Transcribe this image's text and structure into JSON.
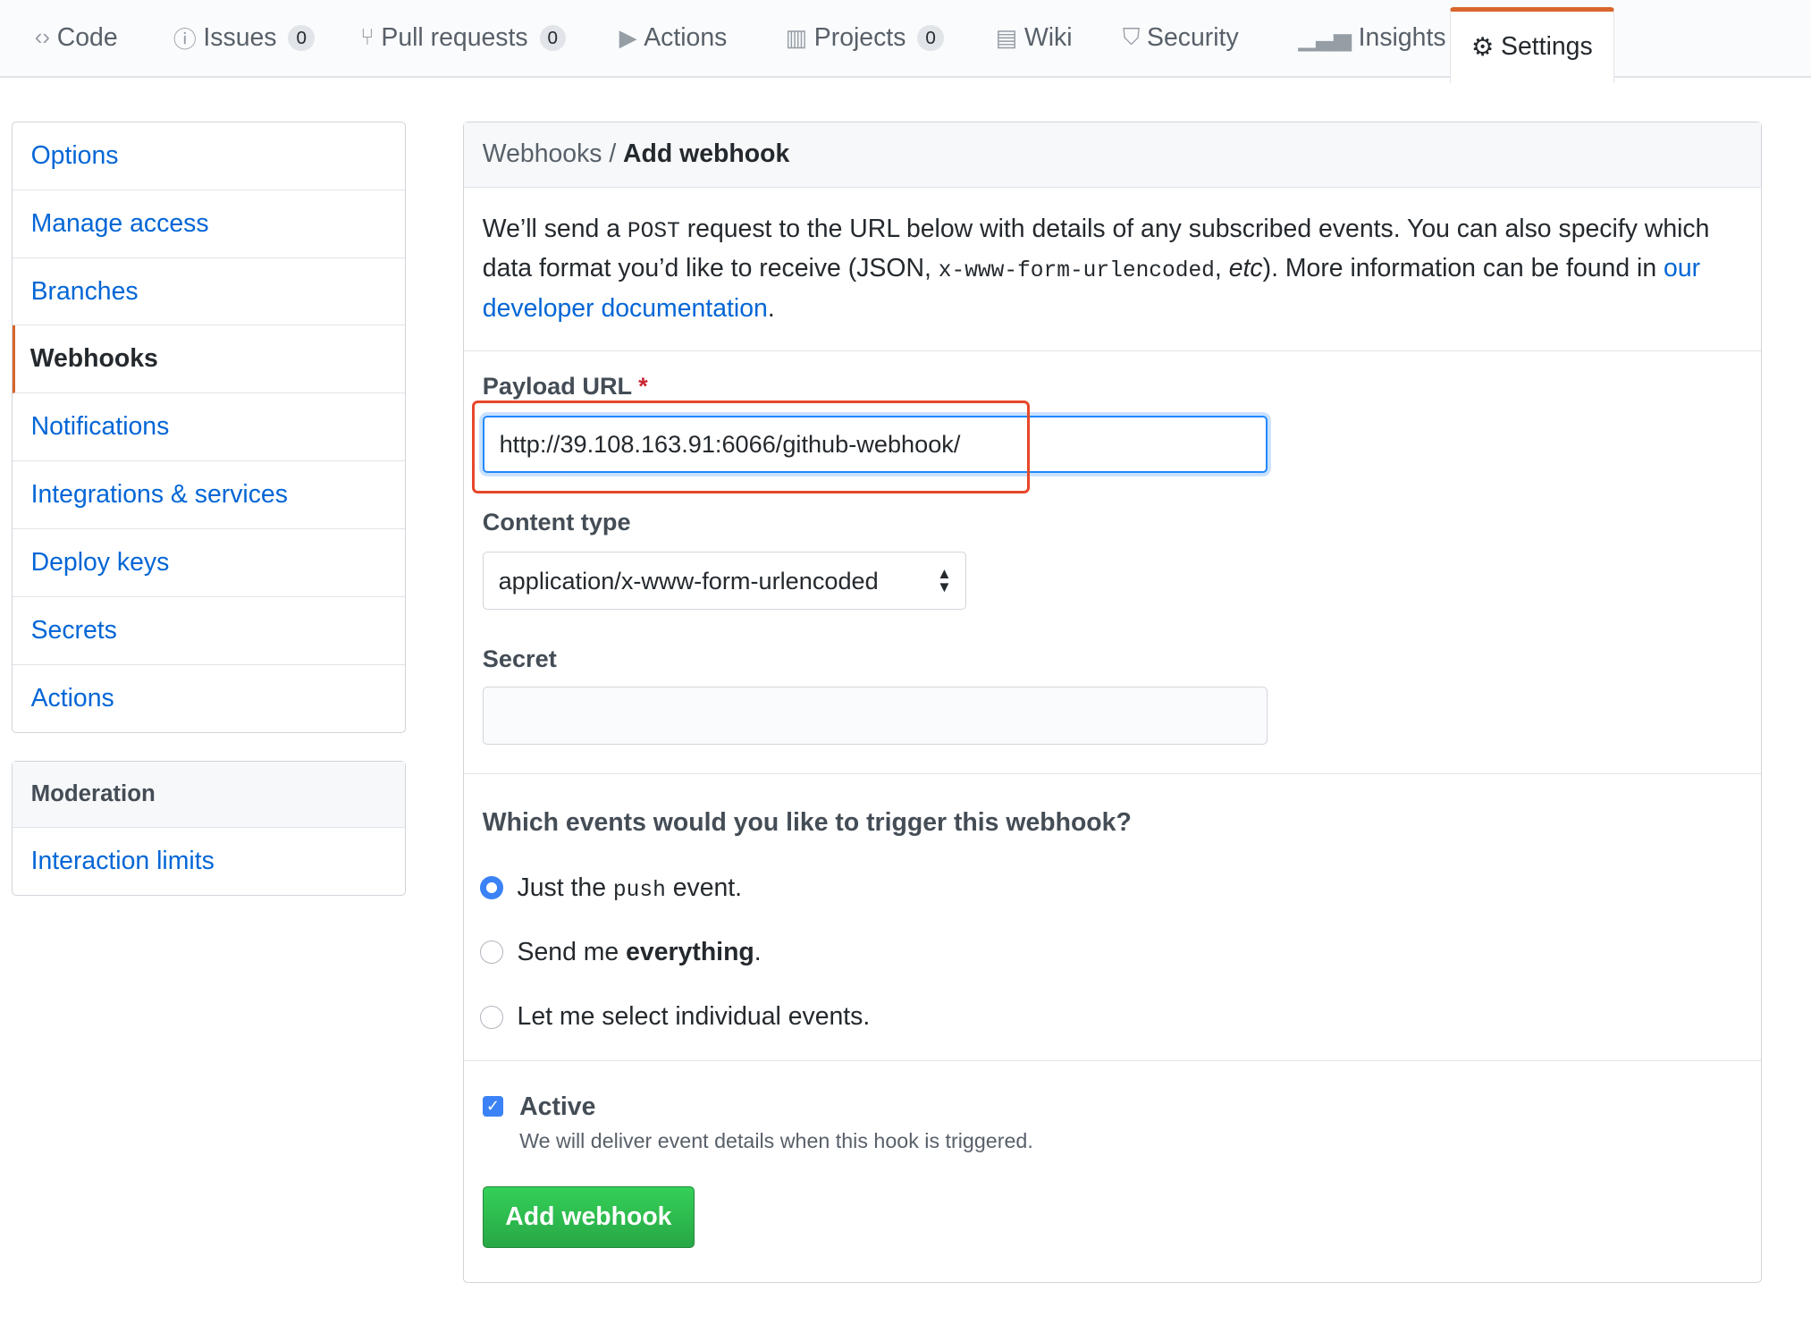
{
  "tabs": [
    {
      "label": "Code",
      "icon": "code-icon"
    },
    {
      "label": "Issues",
      "count": "0",
      "icon": "issue-icon"
    },
    {
      "label": "Pull requests",
      "count": "0",
      "icon": "pull-request-icon"
    },
    {
      "label": "Actions",
      "icon": "play-icon"
    },
    {
      "label": "Projects",
      "count": "0",
      "icon": "project-icon"
    },
    {
      "label": "Wiki",
      "icon": "book-icon"
    },
    {
      "label": "Security",
      "icon": "shield-icon"
    },
    {
      "label": "Insights",
      "icon": "graph-icon"
    },
    {
      "label": "Settings",
      "icon": "gear-icon",
      "selected": true
    }
  ],
  "sidebar": {
    "items": [
      "Options",
      "Manage access",
      "Branches",
      "Webhooks",
      "Notifications",
      "Integrations & services",
      "Deploy keys",
      "Secrets",
      "Actions"
    ],
    "active": "Webhooks",
    "moderation": {
      "heading": "Moderation",
      "items": [
        "Interaction limits"
      ]
    }
  },
  "main": {
    "breadcrumb_parent": "Webhooks /",
    "breadcrumb_current": "Add webhook",
    "intro_1": "We’ll send a ",
    "intro_post": "POST",
    "intro_2": " request to the URL below with details of any subscribed events. You can also specify which data format you’d like to receive (JSON, ",
    "intro_code": "x-www-form-urlencoded",
    "intro_3": ", ",
    "intro_etc": "etc",
    "intro_4": "). More information can be found in ",
    "intro_link": "our developer documentation",
    "intro_5": ".",
    "payload_label": "Payload URL",
    "required_mark": "*",
    "payload_value": "http://39.108.163.91:6066/github-webhook/",
    "content_type_label": "Content type",
    "content_type_value": "application/x-www-form-urlencoded",
    "secret_label": "Secret",
    "secret_value": "",
    "events_question": "Which events would you like to trigger this webhook?",
    "radio_1a": "Just the ",
    "radio_1code": "push",
    "radio_1b": " event.",
    "radio_2a": "Send me ",
    "radio_2b": "everything",
    "radio_2c": ".",
    "radio_3": "Let me select individual events.",
    "selected_event": "push",
    "active_label": "Active",
    "active_checked": true,
    "active_help": "We will deliver event details when this hook is triggered.",
    "submit_label": "Add webhook"
  },
  "colors": {
    "accent": "#d8652b",
    "link": "#0366d6",
    "button": "#28a745",
    "highlight_box": "#e8472a"
  }
}
